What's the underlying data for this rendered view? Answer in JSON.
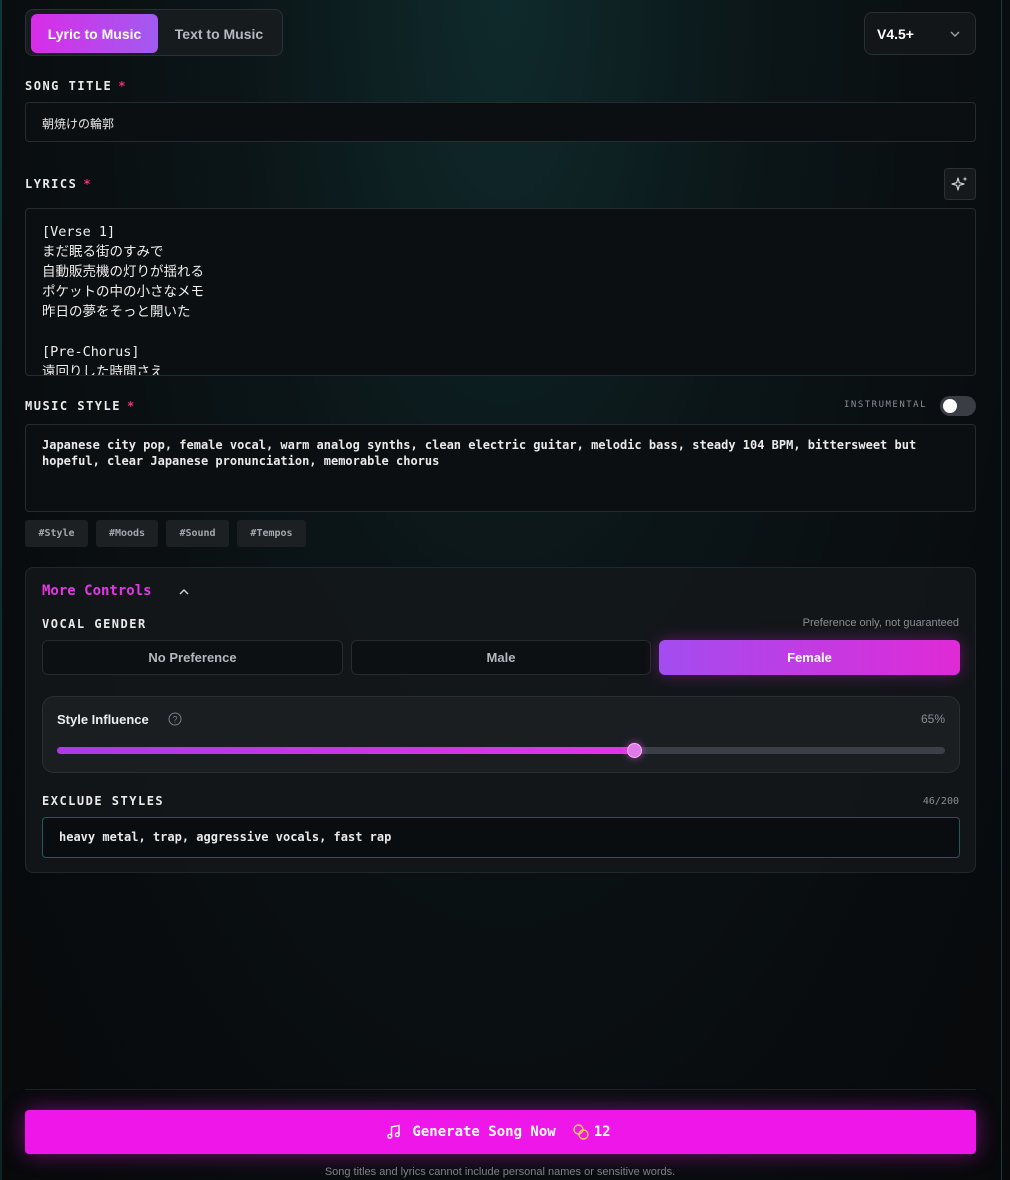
{
  "mode_tabs": {
    "lyric": "Lyric to Music",
    "text": "Text to Music"
  },
  "version": {
    "value": "V4.5+"
  },
  "song_title": {
    "label": "SONG TITLE",
    "required": "*",
    "value": "朝焼けの輪郭"
  },
  "lyrics": {
    "label": "LYRICS",
    "required": "*",
    "value": "[Verse 1]\nまだ眠る街のすみで\n自動販売機の灯りが揺れる\nポケットの中の小さなメモ\n昨日の夢をそっと開いた\n\n[Pre-Chorus]\n遠回りした時間さえ"
  },
  "music_style": {
    "label": "MUSIC STYLE",
    "required": "*",
    "instrumental_label": "INSTRUMENTAL",
    "instrumental_on": false,
    "value": "Japanese city pop, female vocal, warm analog synths, clean electric guitar, melodic bass, steady 104 BPM, bittersweet but hopeful, clear Japanese pronunciation, memorable chorus",
    "tags": [
      "#Style",
      "#Moods",
      "#Sound",
      "#Tempos"
    ]
  },
  "more_controls": {
    "title": "More Controls",
    "vocal_gender_label": "VOCAL GENDER",
    "preference_note": "Preference only, not guaranteed",
    "options": [
      "No Preference",
      "Male",
      "Female"
    ],
    "selected": "Female",
    "style_influence": {
      "label": "Style Influence",
      "value_text": "65%",
      "value": 0.65
    },
    "exclude_styles": {
      "label": "EXCLUDE STYLES",
      "count": "46/200",
      "value": "heavy metal, trap, aggressive vocals, fast rap"
    }
  },
  "generate": {
    "label": "Generate Song Now",
    "credits": "12"
  },
  "disclaimer": "Song titles and lyrics cannot include personal names or sensitive words.",
  "colors": {
    "accent": "#ee16e8",
    "accent_purple": "#a15bf0",
    "required": "#ff2d6a"
  }
}
